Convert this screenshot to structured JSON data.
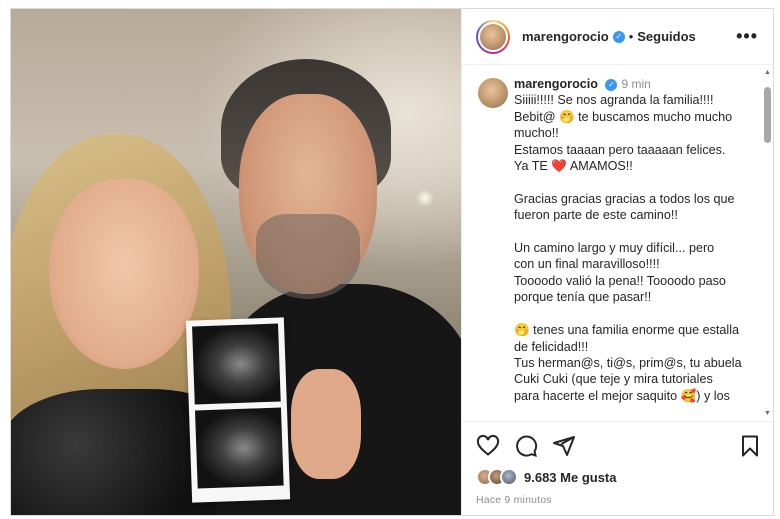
{
  "post": {
    "username": "marengorocio",
    "follow_status": "Seguidos",
    "separator": "•",
    "more_label": "•••"
  },
  "caption": {
    "username": "marengorocio",
    "time": "9 min",
    "text": "Siiiii!!!!! Se nos agranda la familia!!!!\nBebit@ 🤭 te buscamos mucho mucho\nmucho!!\nEstamos taaaan pero taaaaan felices.\nYa TE ❤️ AMAMOS!!\n\nGracias gracias gracias a todos los que\nfueron parte de este camino!!\n\nUn camino largo y muy difícil... pero\ncon un final maravilloso!!!!\nToooodo valió la pena!! Toooodo paso\nporque tenía que pasar!!\n\n🤭 tenes una familia enorme que estalla\nde felicidad!!!\nTus herman@s, ti@s, prim@s, tu abuela\nCuki Cuki (que teje y mira tutoriales\npara hacerte el mejor saquito 🥰) y los"
  },
  "scroll": {
    "up_arrow": "▲",
    "down_arrow": "▼"
  },
  "engagement": {
    "likes": "9.683 Me gusta",
    "posted_ago": "Hace 9 minutos"
  },
  "icons": {
    "like": "heart-icon",
    "comment": "comment-icon",
    "share": "share-icon",
    "save": "bookmark-icon",
    "verified": "verified-badge-icon"
  },
  "colors": {
    "verified": "#3897f0",
    "text": "#262626",
    "muted": "#8e8e8e"
  }
}
